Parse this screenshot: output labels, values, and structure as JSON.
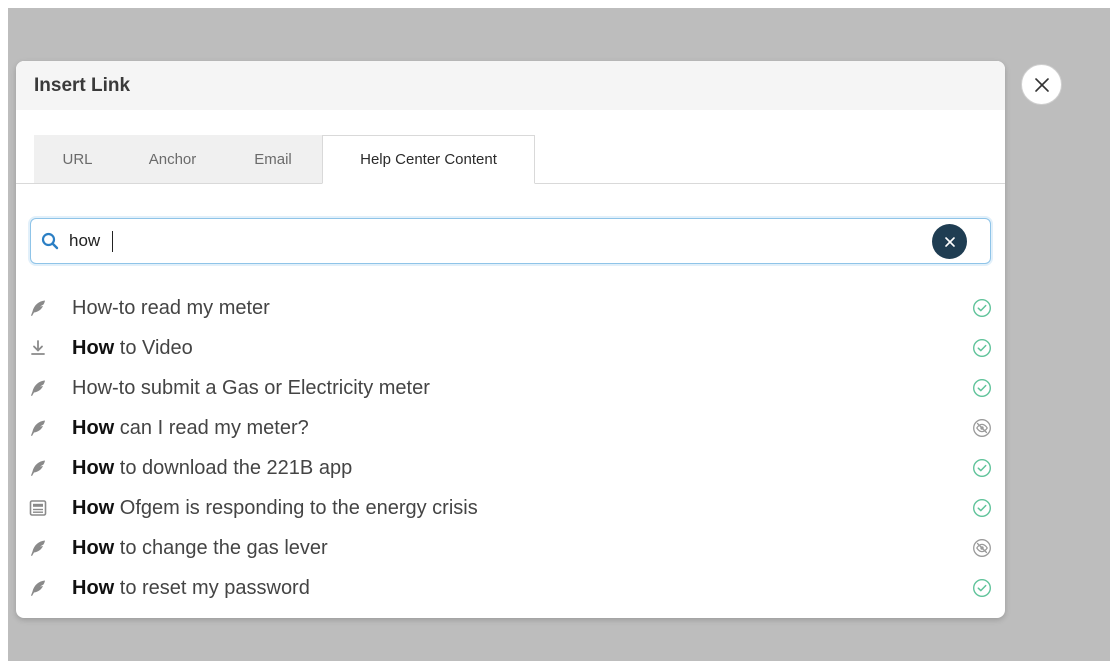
{
  "modal": {
    "title": "Insert Link"
  },
  "tabs": [
    {
      "label": "URL",
      "active": false
    },
    {
      "label": "Anchor",
      "active": false
    },
    {
      "label": "Email",
      "active": false
    },
    {
      "label": "Help Center Content",
      "active": true
    }
  ],
  "search": {
    "value": "how",
    "icon": "search-icon",
    "clear_icon": "clear-icon"
  },
  "results": [
    {
      "icon": "feather-icon",
      "bold": "",
      "text": "How-to read my meter",
      "status": "published"
    },
    {
      "icon": "download-icon",
      "bold": "How",
      "text": " to Video",
      "status": "published"
    },
    {
      "icon": "feather-icon",
      "bold": "",
      "text": "How-to submit a Gas or Electricity meter",
      "status": "published"
    },
    {
      "icon": "feather-icon",
      "bold": "How",
      "text": " can I read my meter?",
      "status": "hidden"
    },
    {
      "icon": "feather-icon",
      "bold": "How",
      "text": " to download the 221B app",
      "status": "published"
    },
    {
      "icon": "news-icon",
      "bold": "How",
      "text": " Ofgem is responding to the energy crisis",
      "status": "published"
    },
    {
      "icon": "feather-icon",
      "bold": "How",
      "text": " to change the gas lever",
      "status": "hidden"
    },
    {
      "icon": "feather-icon",
      "bold": "How",
      "text": " to reset my password",
      "status": "published"
    }
  ],
  "colors": {
    "published": "#5fc39a",
    "hidden": "#9a9a9a",
    "accent": "#2b7fc4",
    "clear_button": "#1f3d52"
  }
}
